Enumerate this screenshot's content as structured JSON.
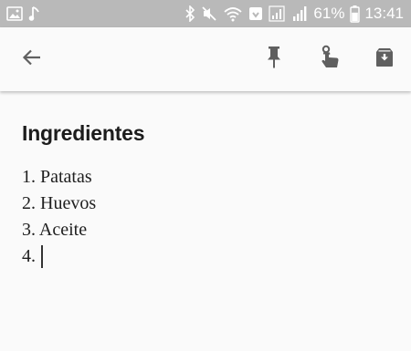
{
  "status_bar": {
    "left_icons": [
      "gallery-icon",
      "music-note-icon"
    ],
    "right_icons": [
      "bluetooth-icon",
      "mute-icon",
      "wifi-icon",
      "data-saver-icon",
      "signal-icon",
      "signal-icon"
    ],
    "battery_percent": "61%",
    "battery_level": 0.61,
    "time": "13:41",
    "background": "#b9b9b9"
  },
  "toolbar": {
    "icons": [
      "back-arrow-icon",
      "pin-icon",
      "reminder-icon",
      "archive-icon"
    ]
  },
  "note": {
    "title": "Ingredientes",
    "lines": [
      "1. Patatas",
      "2. Huevos",
      "3. Aceite",
      "4."
    ]
  }
}
